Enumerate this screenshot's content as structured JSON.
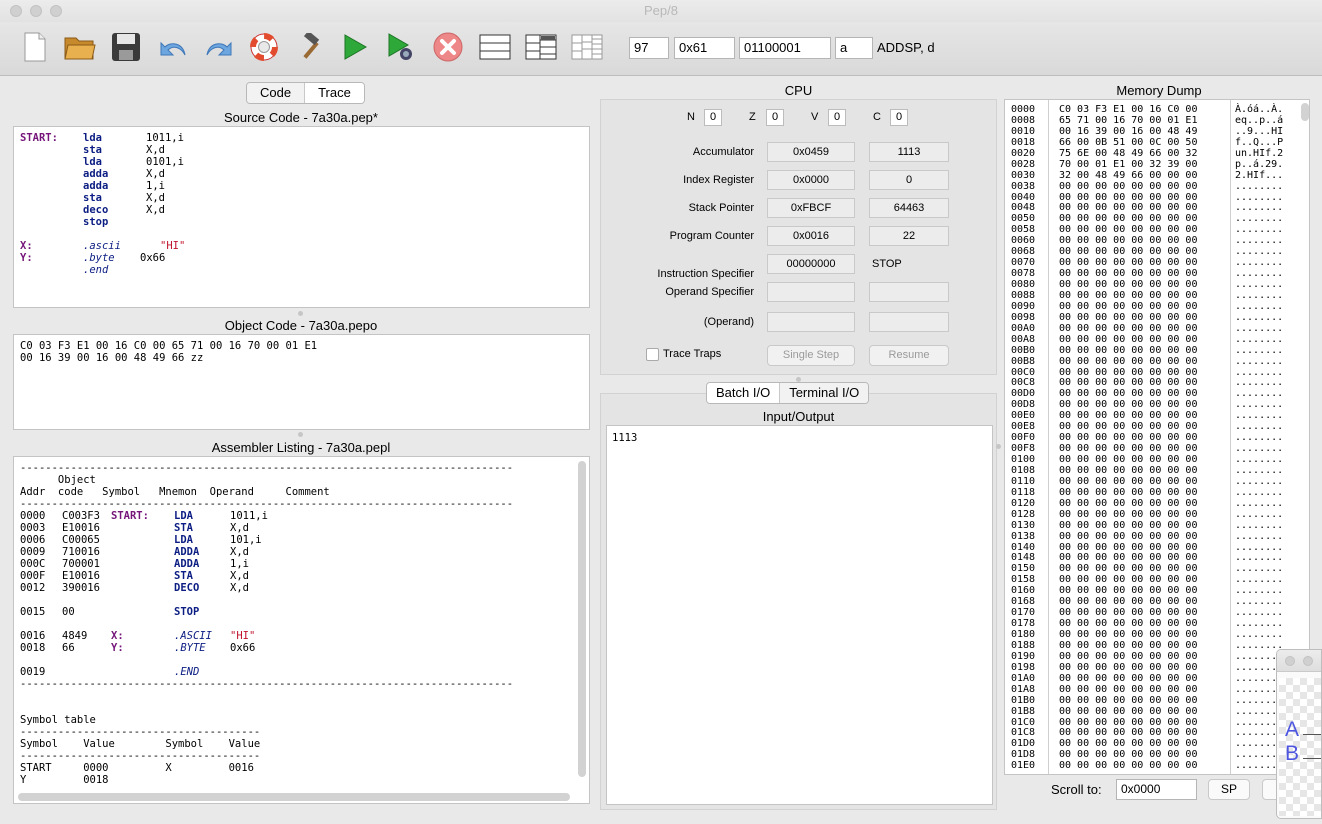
{
  "window": {
    "title": "Pep/8"
  },
  "toolbar": {
    "icons": [
      "new-file-icon",
      "open-folder-icon",
      "save-disk-icon",
      "undo-icon",
      "redo-icon",
      "help-lifebuoy-icon",
      "build-hammer-icon",
      "run-play-icon",
      "debug-run-icon",
      "stop-icon",
      "layout-single-icon",
      "layout-split-icon",
      "layout-grid-icon"
    ],
    "decimal": "97",
    "hex": "0x61",
    "binary": "01100001",
    "ascii": "a",
    "instruction": "ADDSP, d"
  },
  "left_tabs": {
    "code": "Code",
    "trace": "Trace"
  },
  "source": {
    "title": "Source Code - 7a30a.pep*",
    "lines": [
      {
        "label": "START:",
        "op": "lda",
        "arg": "1011,i"
      },
      {
        "label": "",
        "op": "sta",
        "arg": "X,d"
      },
      {
        "label": "",
        "op": "lda",
        "arg": "0101,i"
      },
      {
        "label": "",
        "op": "adda",
        "arg": "X,d"
      },
      {
        "label": "",
        "op": "adda",
        "arg": "1,i"
      },
      {
        "label": "",
        "op": "sta",
        "arg": "X,d"
      },
      {
        "label": "",
        "op": "deco",
        "arg": "X,d"
      },
      {
        "label": "",
        "op": "stop",
        "arg": ""
      },
      {
        "label": "",
        "op": "",
        "arg": ""
      },
      {
        "label": "X:",
        "op": ".ascii",
        "arg": "\"HI\""
      },
      {
        "label": "Y:",
        "op": ".byte",
        "arg": "0x66"
      },
      {
        "label": "",
        "op": ".end",
        "arg": ""
      }
    ]
  },
  "object": {
    "title": "Object Code - 7a30a.pepo",
    "lines": [
      "C0 03 F3 E1 00 16 C0 00 65 71 00 16 70 00 01 E1",
      "00 16 39 00 16 00 48 49 66 zz"
    ]
  },
  "listing": {
    "title": "Assembler Listing - 7a30a.pepl",
    "rule": "------------------------------------------------------------------------------",
    "header1": "      Object",
    "header2": "Addr  code   Symbol   Mnemon  Operand     Comment",
    "rows": [
      {
        "addr": "0000",
        "code": "C003F3",
        "sym": "START:",
        "mn": "LDA",
        "opd": "1011,i"
      },
      {
        "addr": "0003",
        "code": "E10016",
        "sym": "",
        "mn": "STA",
        "opd": "X,d"
      },
      {
        "addr": "0006",
        "code": "C00065",
        "sym": "",
        "mn": "LDA",
        "opd": "101,i"
      },
      {
        "addr": "0009",
        "code": "710016",
        "sym": "",
        "mn": "ADDA",
        "opd": "X,d"
      },
      {
        "addr": "000C",
        "code": "700001",
        "sym": "",
        "mn": "ADDA",
        "opd": "1,i"
      },
      {
        "addr": "000F",
        "code": "E10016",
        "sym": "",
        "mn": "STA",
        "opd": "X,d"
      },
      {
        "addr": "0012",
        "code": "390016",
        "sym": "",
        "mn": "DECO",
        "opd": "X,d"
      },
      {
        "addr": "",
        "code": "",
        "sym": "",
        "mn": "",
        "opd": ""
      },
      {
        "addr": "0015",
        "code": "00",
        "sym": "",
        "mn": "STOP",
        "opd": ""
      },
      {
        "addr": "",
        "code": "",
        "sym": "",
        "mn": "",
        "opd": ""
      },
      {
        "addr": "0016",
        "code": "4849",
        "sym": "X:",
        "mn": ".ASCII",
        "opd": "\"HI\""
      },
      {
        "addr": "0018",
        "code": "66",
        "sym": "Y:",
        "mn": ".BYTE",
        "opd": "0x66"
      },
      {
        "addr": "",
        "code": "",
        "sym": "",
        "mn": "",
        "opd": ""
      },
      {
        "addr": "0019",
        "code": "",
        "sym": "",
        "mn": ".END",
        "opd": ""
      }
    ],
    "symtab_title": "Symbol table",
    "symtab_rule": "--------------------------------------",
    "symtab_header": "Symbol    Value        Symbol    Value",
    "symtab_rows": [
      "START     0000         X         0016",
      "Y         0018"
    ]
  },
  "cpu": {
    "title": "CPU",
    "flags": [
      {
        "name": "N",
        "value": "0"
      },
      {
        "name": "Z",
        "value": "0"
      },
      {
        "name": "V",
        "value": "0"
      },
      {
        "name": "C",
        "value": "0"
      }
    ],
    "registers": [
      {
        "label": "Accumulator",
        "hex": "0x0459",
        "dec": "1113"
      },
      {
        "label": "Index Register",
        "hex": "0x0000",
        "dec": "0"
      },
      {
        "label": "Stack Pointer",
        "hex": "0xFBCF",
        "dec": "64463"
      },
      {
        "label": "Program Counter",
        "hex": "0x0016",
        "dec": "22"
      }
    ],
    "instr_spec": {
      "label": "Instruction Specifier",
      "bin": "00000000",
      "mnemonic": "STOP"
    },
    "operand_spec": {
      "label": "Operand Specifier",
      "hex": "",
      "dec": ""
    },
    "operand": {
      "label": "(Operand)",
      "hex": "",
      "dec": ""
    },
    "trace_traps": "Trace Traps",
    "single_step": "Single Step",
    "resume": "Resume"
  },
  "io_tabs": {
    "batch": "Batch I/O",
    "terminal": "Terminal I/O"
  },
  "io": {
    "title": "Input/Output",
    "text": "1113"
  },
  "memory": {
    "title": "Memory Dump",
    "rows": [
      {
        "addr": "0000",
        "bytes": "C0 03 F3 E1 00 16 C0 00",
        "ascii": "À.óá..À."
      },
      {
        "addr": "0008",
        "bytes": "65 71 00 16 70 00 01 E1",
        "ascii": "eq..p..á"
      },
      {
        "addr": "0010",
        "bytes": "00 16 39 00 16 00 48 49",
        "ascii": "..9...HI"
      },
      {
        "addr": "0018",
        "bytes": "66 00 0B 51 00 0C 00 50",
        "ascii": "f..Q...P"
      },
      {
        "addr": "0020",
        "bytes": "75 6E 00 48 49 66 00 32",
        "ascii": "un.HIf.2"
      },
      {
        "addr": "0028",
        "bytes": "70 00 01 E1 00 32 39 00",
        "ascii": "p..á.29."
      },
      {
        "addr": "0030",
        "bytes": "32 00 48 49 66 00 00 00",
        "ascii": "2.HIf..."
      },
      {
        "addr": "0038",
        "bytes": "00 00 00 00 00 00 00 00",
        "ascii": "........"
      },
      {
        "addr": "0040",
        "bytes": "00 00 00 00 00 00 00 00",
        "ascii": "........"
      },
      {
        "addr": "0048",
        "bytes": "00 00 00 00 00 00 00 00",
        "ascii": "........"
      },
      {
        "addr": "0050",
        "bytes": "00 00 00 00 00 00 00 00",
        "ascii": "........"
      },
      {
        "addr": "0058",
        "bytes": "00 00 00 00 00 00 00 00",
        "ascii": "........"
      },
      {
        "addr": "0060",
        "bytes": "00 00 00 00 00 00 00 00",
        "ascii": "........"
      },
      {
        "addr": "0068",
        "bytes": "00 00 00 00 00 00 00 00",
        "ascii": "........"
      },
      {
        "addr": "0070",
        "bytes": "00 00 00 00 00 00 00 00",
        "ascii": "........"
      },
      {
        "addr": "0078",
        "bytes": "00 00 00 00 00 00 00 00",
        "ascii": "........"
      },
      {
        "addr": "0080",
        "bytes": "00 00 00 00 00 00 00 00",
        "ascii": "........"
      },
      {
        "addr": "0088",
        "bytes": "00 00 00 00 00 00 00 00",
        "ascii": "........"
      },
      {
        "addr": "0090",
        "bytes": "00 00 00 00 00 00 00 00",
        "ascii": "........"
      },
      {
        "addr": "0098",
        "bytes": "00 00 00 00 00 00 00 00",
        "ascii": "........"
      },
      {
        "addr": "00A0",
        "bytes": "00 00 00 00 00 00 00 00",
        "ascii": "........"
      },
      {
        "addr": "00A8",
        "bytes": "00 00 00 00 00 00 00 00",
        "ascii": "........"
      },
      {
        "addr": "00B0",
        "bytes": "00 00 00 00 00 00 00 00",
        "ascii": "........"
      },
      {
        "addr": "00B8",
        "bytes": "00 00 00 00 00 00 00 00",
        "ascii": "........"
      },
      {
        "addr": "00C0",
        "bytes": "00 00 00 00 00 00 00 00",
        "ascii": "........"
      },
      {
        "addr": "00C8",
        "bytes": "00 00 00 00 00 00 00 00",
        "ascii": "........"
      },
      {
        "addr": "00D0",
        "bytes": "00 00 00 00 00 00 00 00",
        "ascii": "........"
      },
      {
        "addr": "00D8",
        "bytes": "00 00 00 00 00 00 00 00",
        "ascii": "........"
      },
      {
        "addr": "00E0",
        "bytes": "00 00 00 00 00 00 00 00",
        "ascii": "........"
      },
      {
        "addr": "00E8",
        "bytes": "00 00 00 00 00 00 00 00",
        "ascii": "........"
      },
      {
        "addr": "00F0",
        "bytes": "00 00 00 00 00 00 00 00",
        "ascii": "........"
      },
      {
        "addr": "00F8",
        "bytes": "00 00 00 00 00 00 00 00",
        "ascii": "........"
      },
      {
        "addr": "0100",
        "bytes": "00 00 00 00 00 00 00 00",
        "ascii": "........"
      },
      {
        "addr": "0108",
        "bytes": "00 00 00 00 00 00 00 00",
        "ascii": "........"
      },
      {
        "addr": "0110",
        "bytes": "00 00 00 00 00 00 00 00",
        "ascii": "........"
      },
      {
        "addr": "0118",
        "bytes": "00 00 00 00 00 00 00 00",
        "ascii": "........"
      },
      {
        "addr": "0120",
        "bytes": "00 00 00 00 00 00 00 00",
        "ascii": "........"
      },
      {
        "addr": "0128",
        "bytes": "00 00 00 00 00 00 00 00",
        "ascii": "........"
      },
      {
        "addr": "0130",
        "bytes": "00 00 00 00 00 00 00 00",
        "ascii": "........"
      },
      {
        "addr": "0138",
        "bytes": "00 00 00 00 00 00 00 00",
        "ascii": "........"
      },
      {
        "addr": "0140",
        "bytes": "00 00 00 00 00 00 00 00",
        "ascii": "........"
      },
      {
        "addr": "0148",
        "bytes": "00 00 00 00 00 00 00 00",
        "ascii": "........"
      },
      {
        "addr": "0150",
        "bytes": "00 00 00 00 00 00 00 00",
        "ascii": "........"
      },
      {
        "addr": "0158",
        "bytes": "00 00 00 00 00 00 00 00",
        "ascii": "........"
      },
      {
        "addr": "0160",
        "bytes": "00 00 00 00 00 00 00 00",
        "ascii": "........"
      },
      {
        "addr": "0168",
        "bytes": "00 00 00 00 00 00 00 00",
        "ascii": "........"
      },
      {
        "addr": "0170",
        "bytes": "00 00 00 00 00 00 00 00",
        "ascii": "........"
      },
      {
        "addr": "0178",
        "bytes": "00 00 00 00 00 00 00 00",
        "ascii": "........"
      },
      {
        "addr": "0180",
        "bytes": "00 00 00 00 00 00 00 00",
        "ascii": "........"
      },
      {
        "addr": "0188",
        "bytes": "00 00 00 00 00 00 00 00",
        "ascii": "........"
      },
      {
        "addr": "0190",
        "bytes": "00 00 00 00 00 00 00 00",
        "ascii": "........"
      },
      {
        "addr": "0198",
        "bytes": "00 00 00 00 00 00 00 00",
        "ascii": "........"
      },
      {
        "addr": "01A0",
        "bytes": "00 00 00 00 00 00 00 00",
        "ascii": "........"
      },
      {
        "addr": "01A8",
        "bytes": "00 00 00 00 00 00 00 00",
        "ascii": "........"
      },
      {
        "addr": "01B0",
        "bytes": "00 00 00 00 00 00 00 00",
        "ascii": "........"
      },
      {
        "addr": "01B8",
        "bytes": "00 00 00 00 00 00 00 00",
        "ascii": "........"
      },
      {
        "addr": "01C0",
        "bytes": "00 00 00 00 00 00 00 00",
        "ascii": "........"
      },
      {
        "addr": "01C8",
        "bytes": "00 00 00 00 00 00 00 00",
        "ascii": "........"
      },
      {
        "addr": "01D0",
        "bytes": "00 00 00 00 00 00 00 00",
        "ascii": "........"
      },
      {
        "addr": "01D8",
        "bytes": "00 00 00 00 00 00 00 00",
        "ascii": "........"
      },
      {
        "addr": "01E0",
        "bytes": "00 00 00 00 00 00 00 00",
        "ascii": "........"
      }
    ],
    "scroll_label": "Scroll to:",
    "scroll_value": "0x0000",
    "sp_button": "SP"
  },
  "overlay": {
    "text_a": "A",
    "text_b": "B"
  },
  "colors": {
    "mnemonic": "#0b1d82",
    "symbol": "#75157a",
    "string": "#c0142b"
  }
}
